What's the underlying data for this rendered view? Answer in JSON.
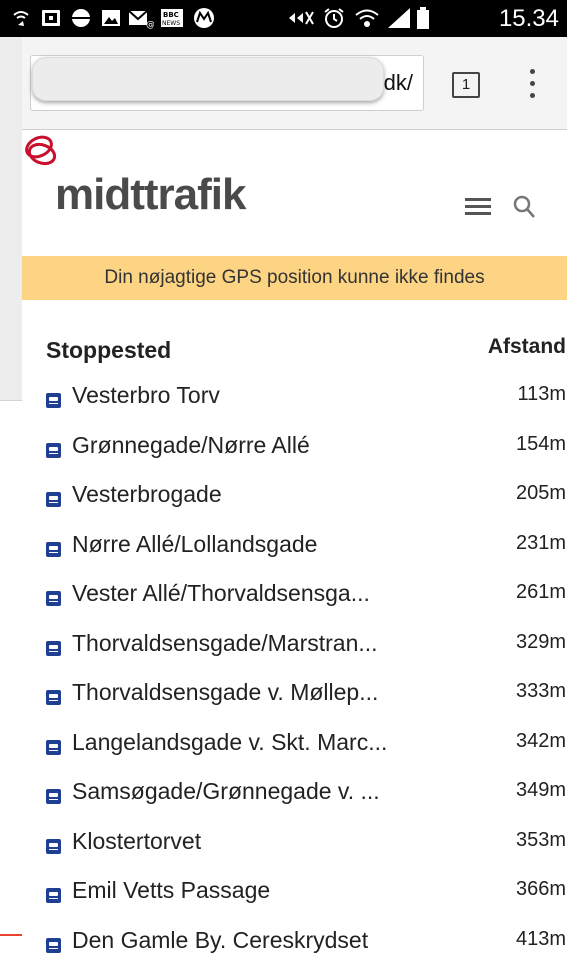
{
  "status_bar": {
    "time": "15.34",
    "icons": [
      "call-forward-icon",
      "screen-icon",
      "circle-icon",
      "image-icon",
      "mail-icon",
      "bbc-news-icon",
      "motorola-icon",
      "nfc-icon",
      "alarm-icon",
      "wifi-icon",
      "signal-icon",
      "battery-icon"
    ]
  },
  "browser": {
    "url_value": "dk/",
    "tab_count": "1"
  },
  "site": {
    "logo_text": "midttrafik",
    "brand_color": "#c8102e"
  },
  "gps_message": "Din nøjagtige GPS position kunne ikke findes",
  "list": {
    "header_stop": "Stoppested",
    "header_distance": "Afstand",
    "rows": [
      {
        "name": "Vesterbro Torv",
        "distance": "113m"
      },
      {
        "name": "Grønnegade/Nørre Allé",
        "distance": "154m"
      },
      {
        "name": "Vesterbrogade",
        "distance": "205m"
      },
      {
        "name": "Nørre Allé/Lollandsgade",
        "distance": "231m"
      },
      {
        "name": "Vester Allé/Thorvaldsensga...",
        "distance": "261m"
      },
      {
        "name": "Thorvaldsensgade/Marstran...",
        "distance": "329m"
      },
      {
        "name": "Thorvaldsensgade v. Møllep...",
        "distance": "333m"
      },
      {
        "name": "Langelandsgade v. Skt. Marc...",
        "distance": "342m"
      },
      {
        "name": "Samsøgade/Grønnegade v. ...",
        "distance": "349m"
      },
      {
        "name": "Klostertorvet",
        "distance": "353m"
      },
      {
        "name": "Emil Vetts Passage",
        "distance": "366m"
      },
      {
        "name": "Den Gamle By. Cereskrydset",
        "distance": "413m"
      }
    ]
  }
}
